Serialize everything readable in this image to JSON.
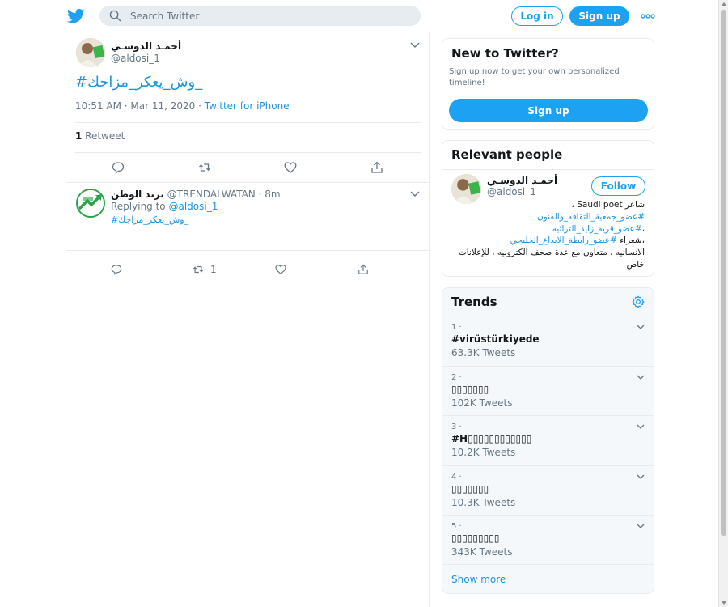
{
  "header": {
    "search_placeholder": "Search Twitter",
    "login_label": "Log in",
    "signup_label": "Sign up"
  },
  "tweet": {
    "author_name": "أحمـد الدوسـي",
    "author_handle": "@aldosi_1",
    "text": "#وش_يعكر_مزاجك_",
    "time": "10:51 AM · Mar 11, 2020",
    "separator": " · ",
    "source": "Twitter for iPhone",
    "retweet_count": "1",
    "retweet_label": " Retweet"
  },
  "reply": {
    "name": "ترند الوطن",
    "handle_time": " @TRENDALWATAN · 8m",
    "replying_prefix": "Replying to ",
    "replying_to": "@aldosi_1",
    "text": "#وش_يعكر_مزاجك_",
    "retweet_count": "1"
  },
  "new_to_twitter": {
    "title": "New to Twitter?",
    "description": "Sign up now to get your own personalized timeline!",
    "button": "Sign up"
  },
  "relevant_people": {
    "title": "Relevant people",
    "name": "أحمـد الدوسـي",
    "handle": "@aldosi_1",
    "follow_label": "Follow",
    "bio_1": "شاعر Saudi poet ،",
    "bio_2": "#عضو_جمعية_الثقافه_والفنون",
    "bio_3": "،",
    "bio_4": "#عضو_قرية_زايد_التراثيه",
    "bio_5": "،شعراء ",
    "bio_6": "#عضو_رابطة_الابداع_الخليجي",
    "bio_7": " الانسانيه ، متعاون مع عدة صحف الكترونيه ، للإعلانات خاص"
  },
  "trends": {
    "title": "Trends",
    "items": [
      {
        "rank": "1 ·",
        "name": "#virüstürkiyede",
        "count": "63.3K Tweets"
      },
      {
        "rank": "2 ·",
        "name": "▯▯▯▯▯▯▯",
        "count": "102K Tweets"
      },
      {
        "rank": "3 ·",
        "name": "#H▯▯▯▯▯▯▯▯▯▯▯▯",
        "count": "10.2K Tweets"
      },
      {
        "rank": "4 ·",
        "name": "▯▯▯▯▯▯▯",
        "count": "10.3K Tweets"
      },
      {
        "rank": "5 ·",
        "name": "▯▯▯▯▯▯▯▯▯",
        "count": "343K Tweets"
      }
    ],
    "show_more": "Show more"
  },
  "colors": {
    "accent": "#1da1f2",
    "link": "#1b95e0",
    "muted": "#657786",
    "border": "#e6ecf0"
  }
}
